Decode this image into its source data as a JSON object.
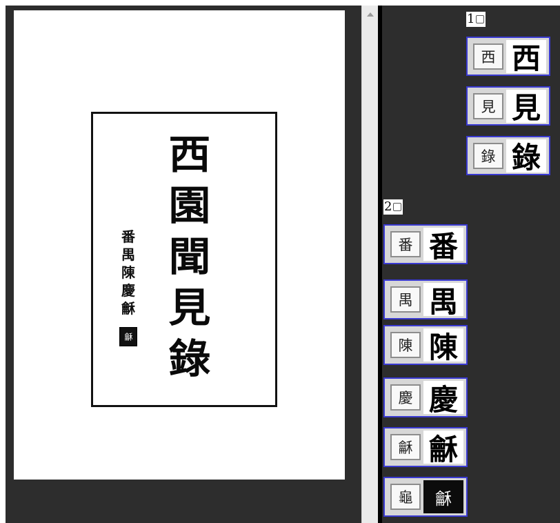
{
  "scan": {
    "title_chars": [
      "西",
      "園",
      "聞",
      "見",
      "錄"
    ],
    "author_chars": [
      "番",
      "禺",
      "陳",
      "慶",
      "龢"
    ],
    "seal_char": "龢"
  },
  "groups": [
    {
      "label": "1",
      "items": [
        {
          "char": "西",
          "glyph": "西"
        },
        {
          "char": "見",
          "glyph": "見"
        },
        {
          "char": "錄",
          "glyph": "錄"
        }
      ]
    },
    {
      "label": "2",
      "items": [
        {
          "char": "番",
          "glyph": "番"
        },
        {
          "char": "禺",
          "glyph": "禺"
        },
        {
          "char": "陳",
          "glyph": "陳"
        },
        {
          "char": "慶",
          "glyph": "慶"
        },
        {
          "char": "龢",
          "glyph": "龢"
        },
        {
          "char": "龜",
          "glyph": "龢"
        }
      ]
    }
  ]
}
